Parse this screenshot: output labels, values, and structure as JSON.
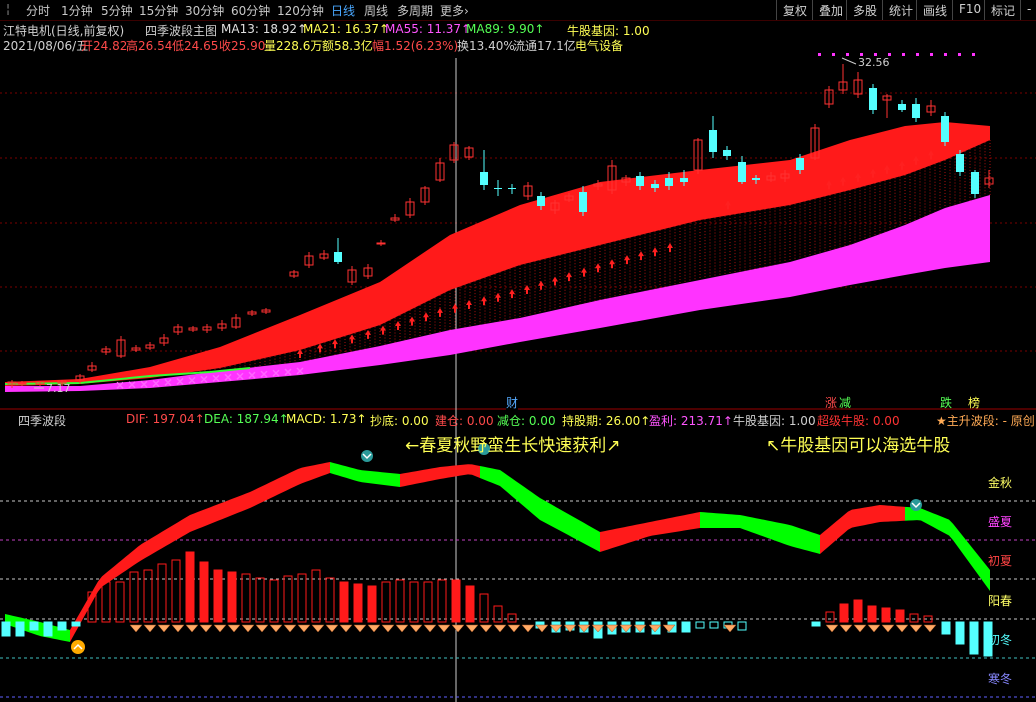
{
  "toolbar": {
    "periods": [
      "分时",
      "1分钟",
      "5分钟",
      "15分钟",
      "30分钟",
      "60分钟",
      "120分钟",
      "日线",
      "周线",
      "多周期",
      "更多›"
    ],
    "active_period": "日线",
    "right": [
      "复权",
      "叠加",
      "多股",
      "统计",
      "画线",
      "F10",
      "标记",
      "-"
    ]
  },
  "header": {
    "stock": "江特电机(日线,前复权)",
    "indicator": "四季波段主图",
    "ma13": "MA13: 18.92↑",
    "ma21": "MA21: 16.37↑",
    "ma55": "MA55: 11.37↑",
    "ma89": "MA89: 9.90↑",
    "gene": "牛股基因: 1.00"
  },
  "quote": {
    "date": "2021/08/06/五",
    "open": "开24.82",
    "high": "高26.54",
    "low": "低24.65",
    "close": "收25.90",
    "volume": "量228.6万",
    "amount": "额58.3亿",
    "amp": "幅1.52(6.23%)",
    "turnover": "换13.40%",
    "float": "流通17.1亿",
    "sector": "电气设备"
  },
  "price_labels": {
    "high_mark": "32.56",
    "low_mark": "7.17"
  },
  "event_tags": {
    "cai": "财",
    "zhang": "涨",
    "jian": "减",
    "die": "跌",
    "bang": "榜"
  },
  "sub": {
    "name": "四季波段",
    "dif": "DIF: 197.04↑",
    "dea": "DEA: 187.94↑",
    "macd": "MACD: 1.73↑",
    "chaodi": "抄底: 0.00",
    "jiancang": "建仓: 0.00",
    "jiancang2": "减仓: 0.00",
    "chigu": "持股期: 26.00↑",
    "yingli": "盈利: 213.71↑",
    "gene": "牛股基因: 1.00",
    "super": "超级牛股: 0.00",
    "rise": "★主升波段: - 原创"
  },
  "annotations": {
    "left": "←春夏秋野蛮生长快速获利↗",
    "right": "↖牛股基因可以海选牛股"
  },
  "seasons": [
    "金秋",
    "盛夏",
    "初夏",
    "阳春",
    "初冬",
    "寒冬"
  ],
  "colors": {
    "up": "#ff3232",
    "down": "#54ffff",
    "band_red": "#ff1a1a",
    "band_magenta": "#ff33ff",
    "green": "#00ff00",
    "yellow": "#ffff66",
    "orange": "#ffaa55"
  }
}
